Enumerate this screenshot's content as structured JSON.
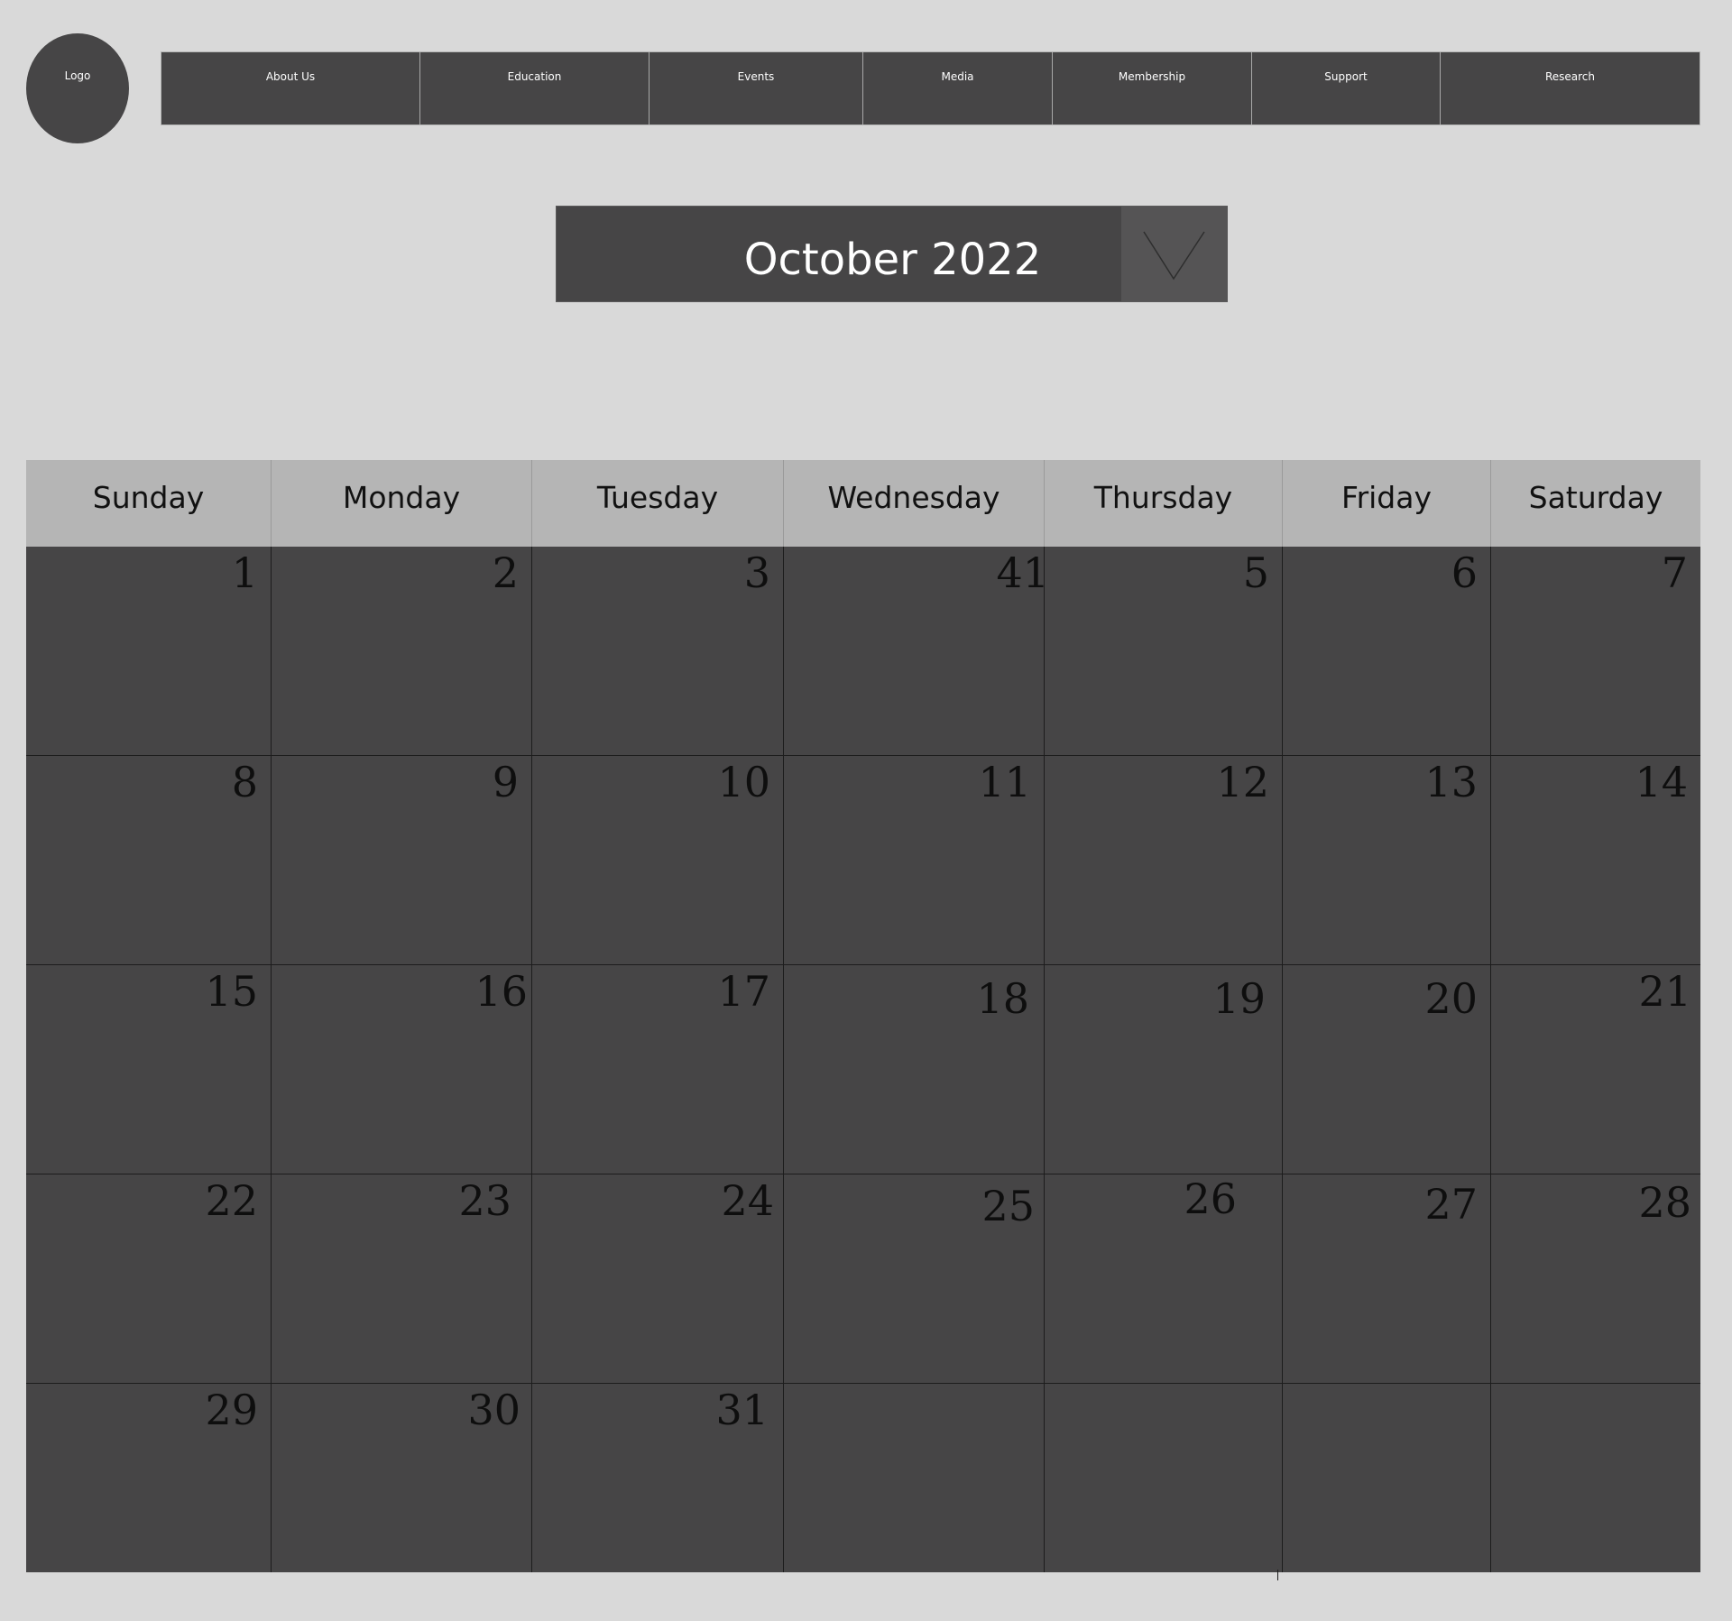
{
  "logo": {
    "label": "Logo"
  },
  "nav": {
    "items": [
      {
        "label": "About Us"
      },
      {
        "label": "Education"
      },
      {
        "label": "Events"
      },
      {
        "label": "Media"
      },
      {
        "label": "Membership"
      },
      {
        "label": "Support"
      },
      {
        "label": "Research"
      }
    ]
  },
  "month_selector": {
    "title": "October 2022",
    "dropdown_icon": "chevron-down-icon"
  },
  "calendar": {
    "weekdays": [
      "Sunday",
      "Monday",
      "Tuesday",
      "Wednesday",
      "Thursday",
      "Friday",
      "Saturday"
    ],
    "weeks": [
      [
        "1",
        "2",
        "3",
        "41",
        "5",
        "6",
        "7"
      ],
      [
        "8",
        "9",
        "10",
        "11",
        "12",
        "13",
        "14"
      ],
      [
        "15",
        "16",
        "17",
        "18",
        "19",
        "20",
        "21"
      ],
      [
        "22",
        "23",
        "24",
        "25",
        "26",
        "27",
        "28"
      ],
      [
        "29",
        "30",
        "31",
        "",
        "",
        "",
        ""
      ]
    ]
  },
  "colors": {
    "page_background": "#d9d9d9",
    "dark_panel": "#464546",
    "header_row": "#b5b5b5",
    "dropdown_button": "#555455"
  }
}
